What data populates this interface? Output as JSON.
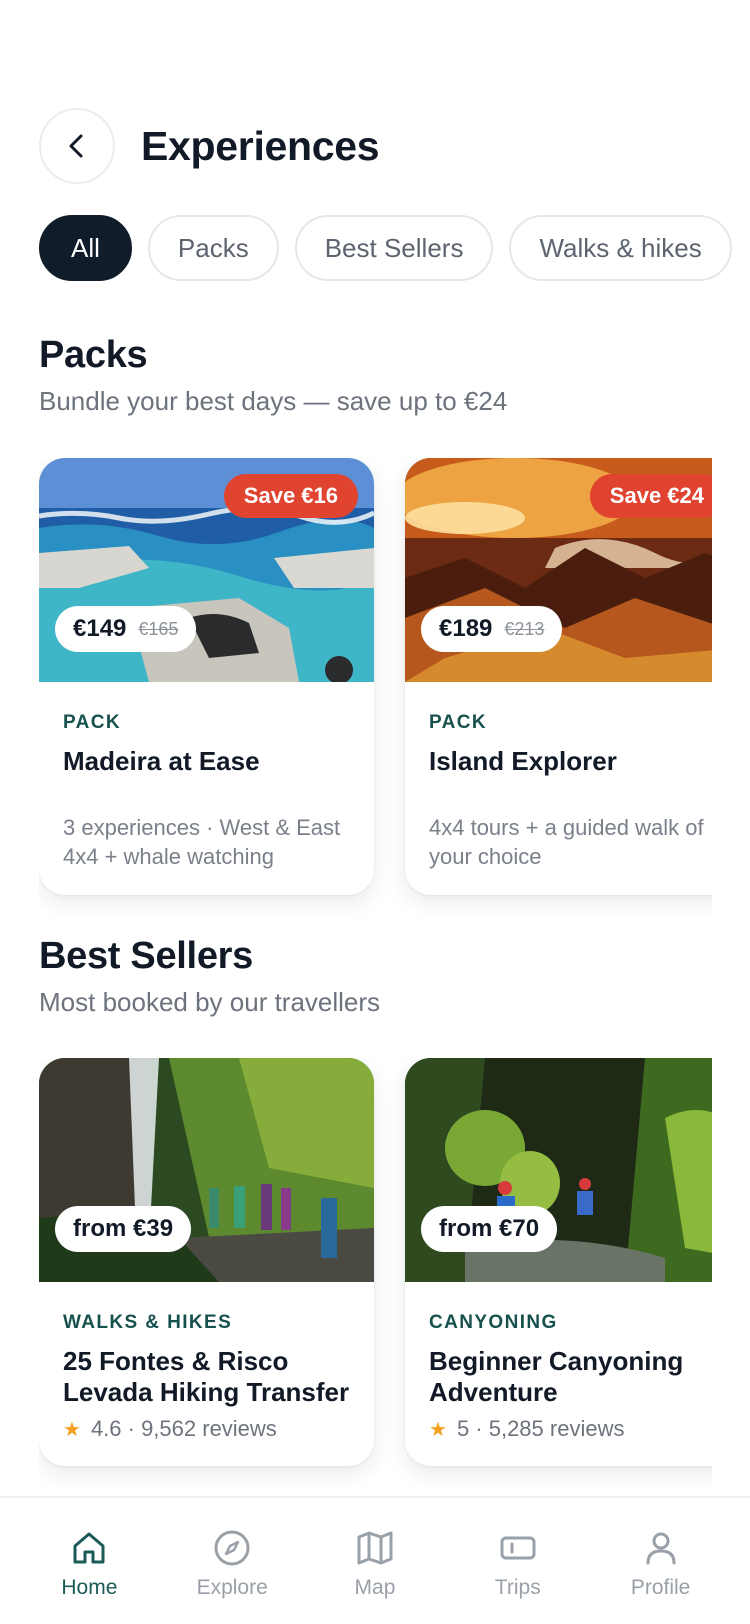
{
  "header": {
    "title": "Experiences"
  },
  "filters": {
    "chips": [
      {
        "label": "All",
        "active": true
      },
      {
        "label": "Packs",
        "active": false
      },
      {
        "label": "Best Sellers",
        "active": false
      },
      {
        "label": "Walks & hikes",
        "active": false
      }
    ]
  },
  "packs": {
    "title": "Packs",
    "subtitle": "Bundle your best days — save up to €24",
    "cards": [
      {
        "badge": "Save €16",
        "price": "€149",
        "old_price": "€165",
        "kicker": "PACK",
        "title": "Madeira at Ease",
        "description": "3 experiences · West & East 4x4 + whale watching"
      },
      {
        "badge": "Save €24",
        "price": "€189",
        "old_price": "€213",
        "kicker": "PACK",
        "title": "Island Explorer",
        "description": "4x4 tours + a guided walk of your choice"
      }
    ]
  },
  "best_sellers": {
    "title": "Best Sellers",
    "subtitle": "Most booked by our travellers",
    "cards": [
      {
        "price": "from €39",
        "kicker": "WALKS & HIKES",
        "title": "25 Fontes & Risco Levada Hiking Transfer",
        "rating_text": "4.6 · 9,562 reviews"
      },
      {
        "price": "from €70",
        "kicker": "CANYONING",
        "title": "Beginner Canyoning Adventure",
        "rating_text": "5 · 5,285 reviews"
      }
    ]
  },
  "tabbar": {
    "tabs": [
      {
        "label": "Home",
        "icon": "home-icon",
        "active": true
      },
      {
        "label": "Explore",
        "icon": "compass-icon",
        "active": false
      },
      {
        "label": "Map",
        "icon": "map-icon",
        "active": false
      },
      {
        "label": "Trips",
        "icon": "ticket-icon",
        "active": false
      },
      {
        "label": "Profile",
        "icon": "user-icon",
        "active": false
      }
    ]
  },
  "colors": {
    "primary_dark": "#101c29",
    "accent_teal": "#1a5b58",
    "save_red": "#e0432f",
    "star": "#f2a01e"
  }
}
